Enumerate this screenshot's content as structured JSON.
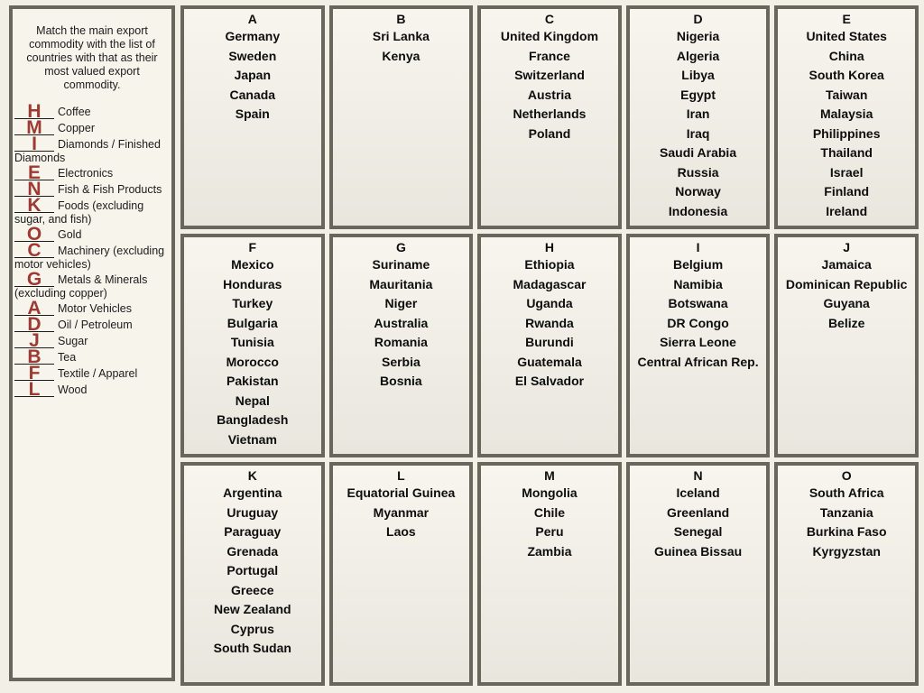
{
  "question_panel": {
    "instructions": "Match the main export commodity with the list of countries with that as their most valued export commodity.",
    "items": [
      {
        "answer": "H",
        "commodity": "Coffee"
      },
      {
        "answer": "M",
        "commodity": "Copper"
      },
      {
        "answer": "I",
        "commodity": "Diamonds / Finished Diamonds"
      },
      {
        "answer": "E",
        "commodity": "Electronics"
      },
      {
        "answer": "N",
        "commodity": "Fish & Fish Products"
      },
      {
        "answer": "K",
        "commodity": "Foods (excluding sugar, and fish)"
      },
      {
        "answer": "O",
        "commodity": "Gold"
      },
      {
        "answer": "C",
        "commodity": "Machinery (excluding motor vehicles)"
      },
      {
        "answer": "G",
        "commodity": "Metals & Minerals (excluding copper)"
      },
      {
        "answer": "A",
        "commodity": "Motor Vehicles"
      },
      {
        "answer": "D",
        "commodity": "Oil / Petroleum"
      },
      {
        "answer": "J",
        "commodity": "Sugar"
      },
      {
        "answer": "B",
        "commodity": "Tea"
      },
      {
        "answer": "F",
        "commodity": "Textile / Apparel"
      },
      {
        "answer": "L",
        "commodity": "Wood"
      }
    ]
  },
  "answer_grid": {
    "rows": [
      [
        {
          "letter": "A",
          "countries": [
            "Germany",
            "Sweden",
            "Japan",
            "Canada",
            "Spain"
          ]
        },
        {
          "letter": "B",
          "countries": [
            "Sri Lanka",
            "Kenya"
          ]
        },
        {
          "letter": "C",
          "countries": [
            "United Kingdom",
            "France",
            "Switzerland",
            "Austria",
            "Netherlands",
            "Poland"
          ]
        },
        {
          "letter": "D",
          "countries": [
            "Nigeria",
            "Algeria",
            "Libya",
            "Egypt",
            "Iran",
            "Iraq",
            "Saudi Arabia",
            "Russia",
            "Norway",
            "Indonesia"
          ]
        },
        {
          "letter": "E",
          "countries": [
            "United States",
            "China",
            "South Korea",
            "Taiwan",
            "Malaysia",
            "Philippines",
            "Thailand",
            "Israel",
            "Finland",
            "Ireland"
          ]
        }
      ],
      [
        {
          "letter": "F",
          "countries": [
            "Mexico",
            "Honduras",
            "Turkey",
            "Bulgaria",
            "Tunisia",
            "Morocco",
            "Pakistan",
            "Nepal",
            "Bangladesh",
            "Vietnam"
          ]
        },
        {
          "letter": "G",
          "countries": [
            "Suriname",
            "Mauritania",
            "Niger",
            "Australia",
            "Romania",
            "Serbia",
            "Bosnia"
          ]
        },
        {
          "letter": "H",
          "countries": [
            "Ethiopia",
            "Madagascar",
            "Uganda",
            "Rwanda",
            "Burundi",
            "Guatemala",
            "El Salvador"
          ]
        },
        {
          "letter": "I",
          "countries": [
            "Belgium",
            "Namibia",
            "Botswana",
            "DR Congo",
            "Sierra Leone",
            "Central African Rep."
          ]
        },
        {
          "letter": "J",
          "countries": [
            "Jamaica",
            "Dominican Republic",
            "Guyana",
            "Belize"
          ]
        }
      ],
      [
        {
          "letter": "K",
          "countries": [
            "Argentina",
            "Uruguay",
            "Paraguay",
            "Grenada",
            "Portugal",
            "Greece",
            "New Zealand",
            "Cyprus",
            "South Sudan"
          ]
        },
        {
          "letter": "L",
          "countries": [
            "Equatorial Guinea",
            "Myanmar",
            "Laos"
          ]
        },
        {
          "letter": "M",
          "countries": [
            "Mongolia",
            "Chile",
            "Peru",
            "Zambia"
          ]
        },
        {
          "letter": "N",
          "countries": [
            "Iceland",
            "Greenland",
            "Senegal",
            "Guinea Bissau"
          ]
        },
        {
          "letter": "O",
          "countries": [
            "South Africa",
            "Tanzania",
            "Burkina Faso",
            "Kyrgyzstan"
          ]
        }
      ]
    ]
  },
  "colors": {
    "answer_letter": "#9c3a33",
    "border": "#6b665c",
    "panel_background": "#f7f4ec",
    "page_background": "#f2efe6",
    "text": "#1b1b1b"
  }
}
